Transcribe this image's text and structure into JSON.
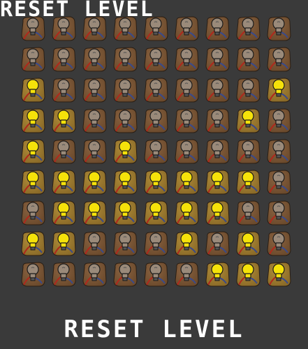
{
  "header": {
    "title": "RESET LEVEL"
  },
  "footer": {
    "reset_label": "RESET LEVEL"
  },
  "colors": {
    "background": "#3a3a3a",
    "tile_off": "#6b4a2c",
    "tile_on": "#8a6a28",
    "bulb_off": "#9a8a7a",
    "bulb_on": "#f5e20a"
  },
  "icon": "lightbulb-icon",
  "board": {
    "rows": 9,
    "cols": 9,
    "lit": [
      [
        0,
        0,
        0,
        0,
        0,
        0,
        0,
        0,
        0
      ],
      [
        0,
        0,
        0,
        0,
        0,
        0,
        0,
        0,
        0
      ],
      [
        1,
        0,
        0,
        0,
        0,
        0,
        0,
        0,
        1
      ],
      [
        1,
        1,
        0,
        0,
        0,
        0,
        0,
        1,
        0
      ],
      [
        1,
        0,
        0,
        1,
        0,
        0,
        0,
        0,
        0
      ],
      [
        1,
        1,
        1,
        1,
        1,
        1,
        1,
        1,
        0
      ],
      [
        0,
        1,
        1,
        1,
        1,
        1,
        1,
        0,
        0
      ],
      [
        1,
        1,
        0,
        0,
        0,
        1,
        0,
        1,
        0
      ],
      [
        0,
        0,
        0,
        0,
        0,
        0,
        1,
        1,
        1
      ]
    ]
  }
}
